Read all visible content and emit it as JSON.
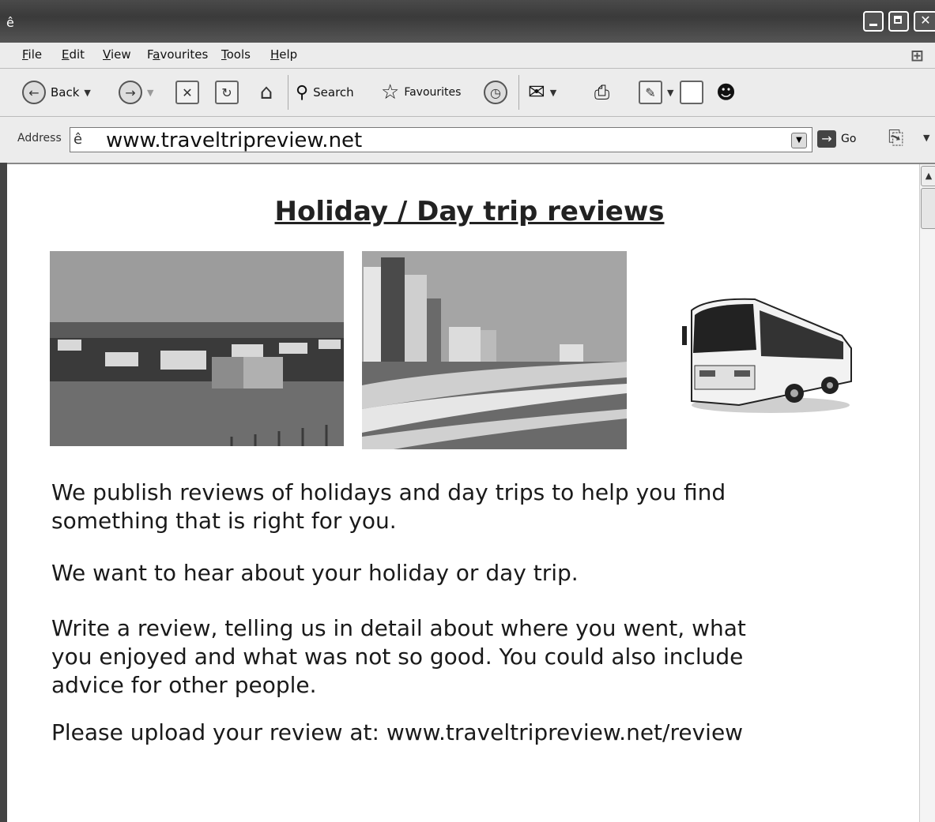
{
  "window": {
    "title": ""
  },
  "menu": [
    {
      "pre": "",
      "u": "F",
      "post": "ile"
    },
    {
      "pre": "",
      "u": "E",
      "post": "dit"
    },
    {
      "pre": "",
      "u": "V",
      "post": "iew"
    },
    {
      "pre": "F",
      "u": "a",
      "post": "vourites"
    },
    {
      "pre": "",
      "u": "T",
      "post": "ools"
    },
    {
      "pre": "",
      "u": "H",
      "post": "elp"
    }
  ],
  "toolbar": {
    "back_label": "Back",
    "search_label": "Search",
    "favourites_label": "Favourites"
  },
  "address": {
    "label": "Address",
    "url": "www.traveltripreview.net",
    "go_label": "Go"
  },
  "page": {
    "title": "Holiday / Day trip reviews",
    "paragraphs": [
      "We publish reviews of holidays and day trips to help you find something that is right for you.",
      "We want to hear about your holiday or day trip.",
      "Write a review, telling us in detail about where you went, what you enjoyed and what was not so good. You could also include advice for other people.",
      "Please upload your review at: www.traveltripreview.net/review"
    ]
  },
  "icons": [
    "ie-icon",
    "minimize-icon",
    "maximize-icon",
    "close-icon",
    "windows-logo-icon",
    "back-arrow-icon",
    "forward-arrow-icon",
    "stop-icon",
    "refresh-icon",
    "home-icon",
    "search-icon",
    "favourites-star-icon",
    "history-icon",
    "mail-icon",
    "print-icon",
    "edit-icon",
    "discuss-icon",
    "messenger-icon",
    "go-arrow-icon",
    "research-icon"
  ]
}
